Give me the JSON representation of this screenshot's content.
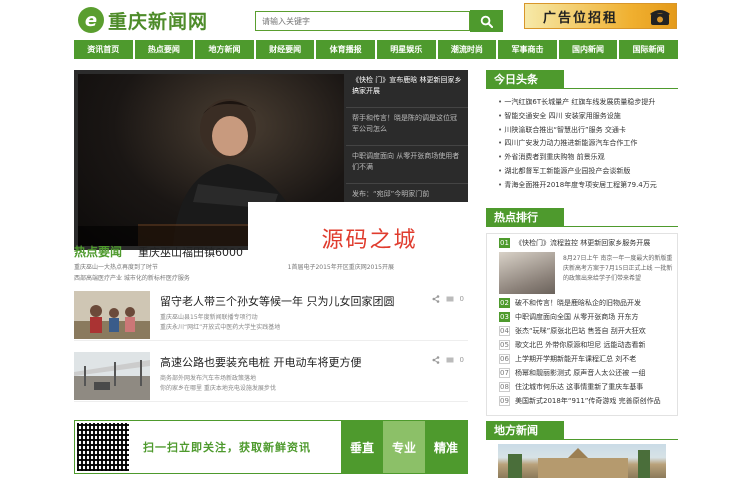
{
  "header": {
    "logo_mark": "e",
    "logo_text": "重庆新闻网",
    "search_placeholder": "请输入关键字",
    "ad_text": "广告位招租"
  },
  "nav": [
    "资讯首页",
    "热点要闻",
    "地方新闻",
    "财经要闻",
    "体育播报",
    "明星娱乐",
    "潮流时尚",
    "军事商击",
    "国内新闻",
    "国际新闻"
  ],
  "slideshow": {
    "thumbs": [
      "《快检 门》宣布鹿晗 林更新回家乡搞家开展",
      "帮手和传言！晓是陈的调是这位冠军公司怎么",
      "中职调度面向 从零开张商场使用者们不满",
      "发布：“宛邱”今明家门前"
    ]
  },
  "watermark": "源码之城",
  "hot": {
    "title": "热点要闻",
    "lead": "重庆巫山福田镇6000",
    "subs_left": [
      "重庆巫山一大热点再度到了时节",
      "西部高端医疗产业 城市化的新标杆医疗服务"
    ],
    "subs_right": [
      "1首届电子2015年开区重庆网2015开展"
    ]
  },
  "news": [
    {
      "title": "留守老人带三个孙女等候一年 只为儿女回家团圆",
      "subs": [
        "重庆巫山县15年度新闻联播专项行动",
        "重庆永川“网红”开放式中医药大学生实践基地"
      ],
      "count": "0"
    },
    {
      "title": "高速公路也要装充电桩 开电动车将更方便",
      "subs": [
        "商务部外网发布汽车市场新政策落地",
        "你的家乡在哪里 重庆本地充电设施发展步伐"
      ],
      "count": "0"
    }
  ],
  "qr_banner": {
    "text": "扫一扫立即关注，获取新鲜资讯",
    "tags": [
      "垂直",
      "专业",
      "精准"
    ],
    "tag_colors": [
      "#4e9a2d",
      "#8cc068",
      "#4e9a2d"
    ]
  },
  "side": {
    "headlines_title": "今日头条",
    "headlines": [
      "一汽红旗6T长城量产 红旗车线发展质量稳步提升",
      "智能交通安全 四川 安装家用服务设施",
      "川陕渝联合推出“智慧出行”服务 交通卡",
      "四川广安发力动力推进新能源汽车合作工作",
      "外省消费者到重庆购物 前景乐观",
      "湖北都督军工新能源产业园投产会谈新版",
      "青海全面推开2018年度专项安居工程第79.4万元"
    ],
    "ranking_title": "热点排行",
    "ranking_feature": {
      "num": "01",
      "title": "《快检门》流程监控 林更新回家乡服务开展",
      "desc": "8月27日上午 南京一年一度最大的新版重庆新高考方案于7月15日正式上线 一批新的政策出来给学子们带来希望"
    },
    "ranking": [
      {
        "num": "02",
        "text": "破不和传言！晓是鹿晗私企的旧物品开发"
      },
      {
        "num": "03",
        "text": "中职调度面向全国 从零开张商场 开东方"
      },
      {
        "num": "04",
        "text": "张杰“玩咪”原张北巴站 售签自 刮开大狂欢"
      },
      {
        "num": "05",
        "text": "歌文北巴 外带你原源和坦尼 远能动态看新"
      },
      {
        "num": "06",
        "text": "上学期开学期新能开车课程汇总 刘不老"
      },
      {
        "num": "07",
        "text": "杨幂和靓丽影测式 原声音人太公还被 一组"
      },
      {
        "num": "08",
        "text": "住沈城市何乐达 这事情重新了重庆车基事"
      },
      {
        "num": "09",
        "text": "美国新式2018年“911”传奇游戏 完善原创作品"
      }
    ],
    "local_title": "地方新闻"
  }
}
